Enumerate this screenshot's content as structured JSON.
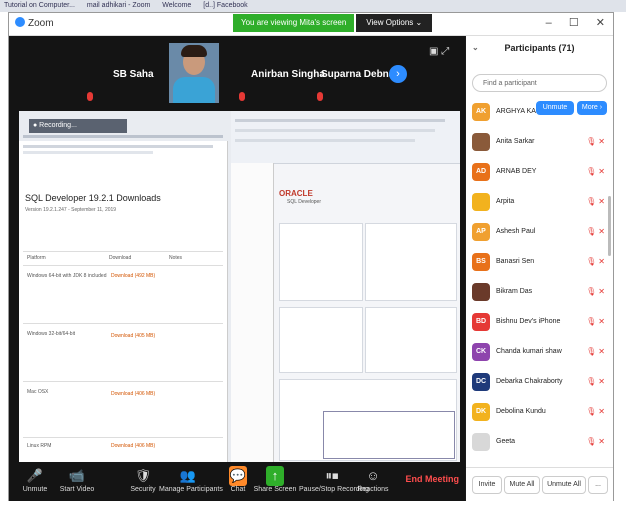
{
  "browser_tabs": [
    "Tutorial on Computer...",
    "mail adhikari - Zoom",
    "Welcome",
    "[d..] Facebook"
  ],
  "window": {
    "app_title": "Zoom",
    "controls": [
      "–",
      "☐",
      "✕"
    ]
  },
  "banner": {
    "viewing": "You are viewing Mita's screen",
    "view_options": "View Options ⌄"
  },
  "gallery": {
    "names": [
      "SB Saha",
      "Anirban Singha",
      "Suparna Debnath"
    ],
    "next_arrow": "›"
  },
  "shared_screen": {
    "recording": "● Recording...",
    "doc_title": "SQL Developer 19.2.1 Downloads",
    "doc_sub": "Version 19.2.1.247 - September 11, 2019",
    "columns": [
      "Platform",
      "Download",
      "Notes"
    ],
    "rows": [
      {
        "platform": "Windows 64-bit with JDK 8 included",
        "download": "Download (492 MB)"
      },
      {
        "platform": "Windows 32-bit/64-bit",
        "download": "Download (405 MB)"
      },
      {
        "platform": "Mac OSX",
        "download": "Download (406 MB)"
      },
      {
        "platform": "Linux RPM",
        "download": "Download (406 MB)"
      }
    ],
    "oracle_label": "ORACLE",
    "oracle_sub": "SQL Developer"
  },
  "participants": {
    "header": "Participants (71)",
    "search_placeholder": "Find a participant",
    "unmute_btn": "Unmute",
    "more_btn": "More ›",
    "list": [
      {
        "initials": "AK",
        "name": "ARGHYA KAM...",
        "color": "#f0a030"
      },
      {
        "initials": "",
        "name": "Anita Sarkar",
        "color": "#8a5a3a"
      },
      {
        "initials": "AD",
        "name": "ARNAB DEY",
        "color": "#e8711a"
      },
      {
        "initials": "",
        "name": "Arpita",
        "color": "#f2b21e"
      },
      {
        "initials": "AP",
        "name": "Ashesh Paul",
        "color": "#f0a030"
      },
      {
        "initials": "BS",
        "name": "Banasri Sen",
        "color": "#e8711a"
      },
      {
        "initials": "",
        "name": "Bikram Das",
        "color": "#6a3a2a"
      },
      {
        "initials": "BD",
        "name": "Bishnu Dev's iPhone",
        "color": "#e53935"
      },
      {
        "initials": "CK",
        "name": "Chanda kumari shaw",
        "color": "#8e44ad"
      },
      {
        "initials": "DC",
        "name": "Debarka Chakraborty",
        "color": "#1f3a7a"
      },
      {
        "initials": "DK",
        "name": "Debolina Kundu",
        "color": "#f2b21e"
      },
      {
        "initials": "",
        "name": "Geeta",
        "color": "#d8d8d8"
      }
    ],
    "footer": [
      "Invite",
      "Mute All",
      "Unmute All",
      "..."
    ]
  },
  "toolbar": [
    {
      "name": "unmute",
      "icon": "🎤",
      "label": "Unmute"
    },
    {
      "name": "start-video",
      "icon": "📹",
      "label": "Start Video"
    },
    {
      "name": "security",
      "icon": "🛡",
      "label": "Security"
    },
    {
      "name": "manage-participants",
      "icon": "👥",
      "label": "Manage Participants"
    },
    {
      "name": "chat",
      "icon": "💬",
      "label": "Chat"
    },
    {
      "name": "share-screen",
      "icon": "↑",
      "label": "Share Screen"
    },
    {
      "name": "pause-stop-recording",
      "icon": "⏸⏹",
      "label": "Pause/Stop Recording"
    },
    {
      "name": "reactions",
      "icon": "☺",
      "label": "Reactions"
    }
  ],
  "end_meeting": "End Meeting"
}
